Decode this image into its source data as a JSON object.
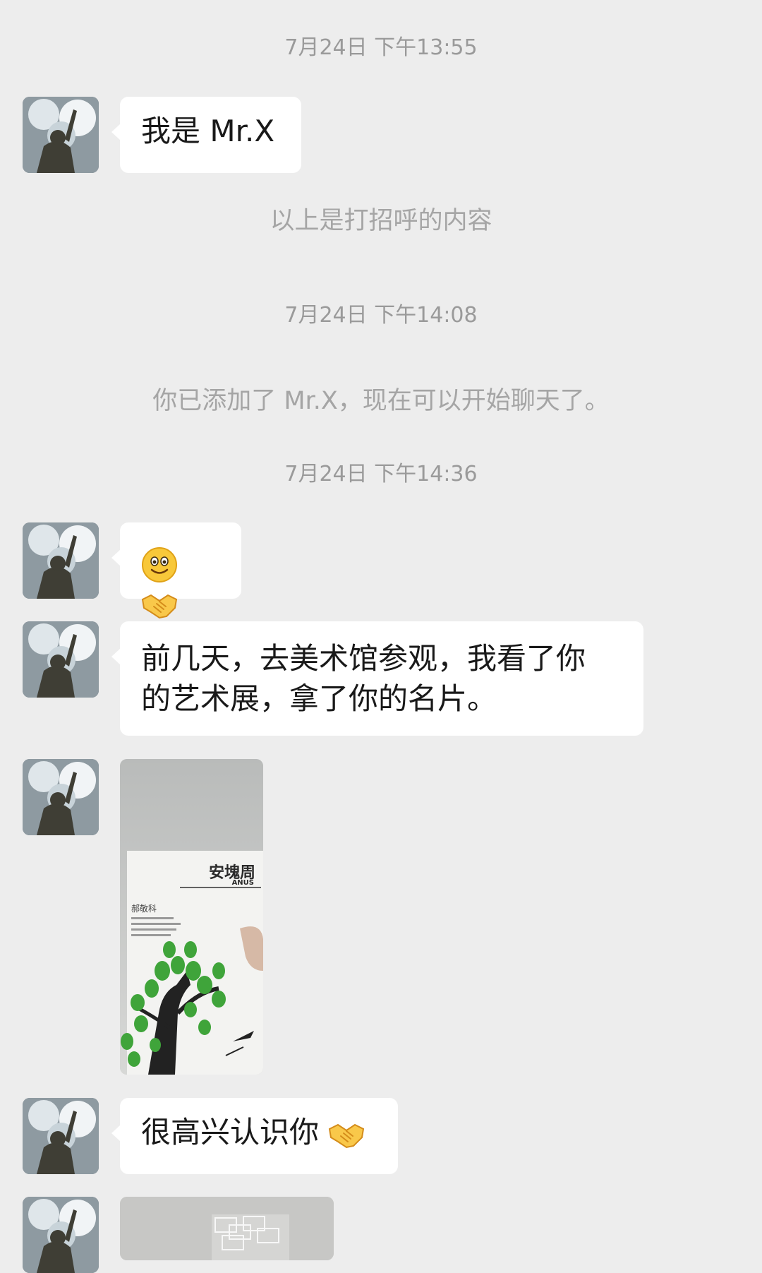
{
  "conversation": {
    "timestamps": [
      "7月24日 下午13:55",
      "7月24日 下午14:08",
      "7月24日 下午14:36"
    ],
    "system_notes": [
      "以上是打招呼的内容",
      "你已添加了 Mr.X，现在可以开始聊天了。"
    ],
    "messages": {
      "greeting": "我是 Mr.X",
      "museum_line1": "前几天，去美术馆参观，我看了你",
      "museum_line2": "的艺术展，拿了你的名片。",
      "nice_to_meet": "很高兴认识你"
    },
    "business_card": {
      "brand": "安塊周",
      "brand_en": "ANUS",
      "person": "郝敬科"
    },
    "emoji_names": [
      "smile-emoji",
      "handshake-emoji"
    ]
  }
}
